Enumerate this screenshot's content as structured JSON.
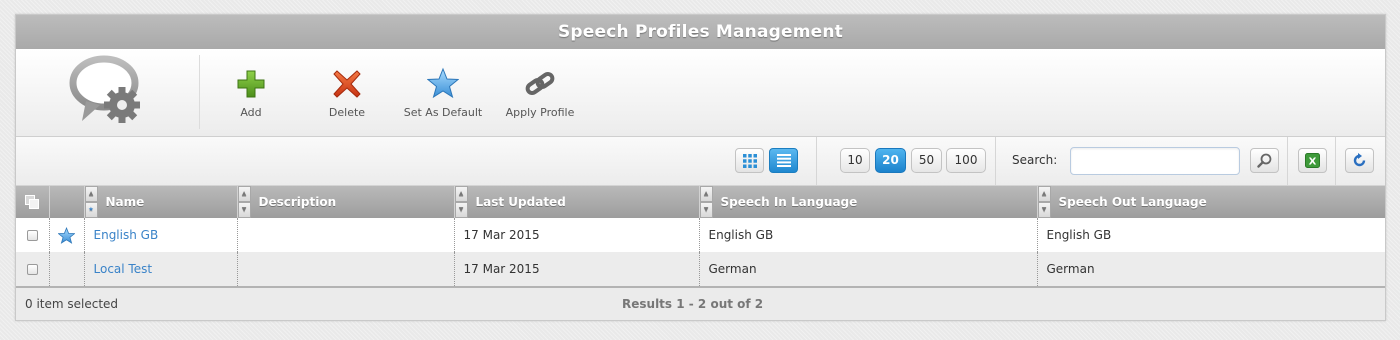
{
  "title": "Speech Profiles Management",
  "toolbar": {
    "logo_icon": "speech-bubble-gear-icon",
    "buttons": [
      {
        "label": "Add",
        "icon": "plus-icon",
        "color": "#5a9a1f"
      },
      {
        "label": "Delete",
        "icon": "x-icon",
        "color": "#d9421b"
      },
      {
        "label": "Set As Default",
        "icon": "star-icon",
        "color": "#4a9ee0"
      },
      {
        "label": "Apply Profile",
        "icon": "chain-link-icon",
        "color": "#555555"
      }
    ]
  },
  "filterbar": {
    "view_buttons": [
      "grid-view-icon",
      "list-view-icon"
    ],
    "active_view": "list",
    "page_sizes": [
      "10",
      "20",
      "50",
      "100"
    ],
    "active_page_size": "20",
    "search_label": "Search:",
    "search_value": "",
    "search_icon": "magnifier-icon",
    "export_icon": "excel-icon",
    "refresh_icon": "refresh-icon"
  },
  "table": {
    "columns": [
      "Name",
      "Description",
      "Last Updated",
      "Speech In Language",
      "Speech Out Language"
    ],
    "rows": [
      {
        "default": true,
        "name": "English GB",
        "description": "",
        "last_updated": "17 Mar 2015",
        "speech_in": "English GB",
        "speech_out": "English GB"
      },
      {
        "default": false,
        "name": "Local Test",
        "description": "",
        "last_updated": "17 Mar 2015",
        "speech_in": "German",
        "speech_out": "German"
      }
    ]
  },
  "footer": {
    "selection": "0 item selected",
    "results": "Results 1 - 2 out of 2"
  },
  "colors": {
    "accent": "#2a8fd6",
    "link": "#3a83c8",
    "header_bg": "#ababab"
  }
}
